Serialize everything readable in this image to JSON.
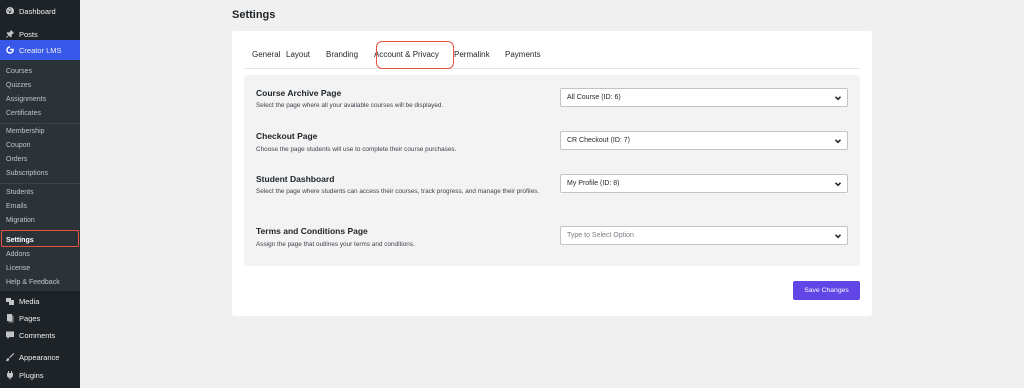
{
  "sidebar": {
    "top": [
      {
        "label": "Dashboard",
        "icon": "dashboard-icon"
      },
      {
        "label": "Posts",
        "icon": "pin-icon"
      },
      {
        "label": "Creator LMS",
        "icon": "creator-lms-icon"
      }
    ],
    "submenu": [
      "Courses",
      "Quizzes",
      "Assignments",
      "Certificates",
      "Membership",
      "Coupon",
      "Orders",
      "Subscriptions",
      "Students",
      "Emails",
      "Migration",
      "Settings",
      "Addons",
      "License",
      "Help & Feedback"
    ],
    "bottom": [
      {
        "label": "Media",
        "icon": "media-icon"
      },
      {
        "label": "Pages",
        "icon": "pages-icon"
      },
      {
        "label": "Comments",
        "icon": "comments-icon"
      },
      {
        "label": "Appearance",
        "icon": "appearance-icon"
      },
      {
        "label": "Plugins",
        "icon": "plugins-icon"
      }
    ]
  },
  "page": {
    "title": "Settings"
  },
  "tabs": [
    "General",
    "Layout",
    "Branding",
    "Account & Privacy",
    "Permalink",
    "Payments"
  ],
  "rows": [
    {
      "title": "Course Archive Page",
      "desc": "Select the page where all your available courses will be displayed.",
      "value": "All Course (ID: 6)"
    },
    {
      "title": "Checkout Page",
      "desc": "Choose the page students will use to complete their course purchases.",
      "value": "CR Checkout (ID: 7)"
    },
    {
      "title": "Student Dashboard",
      "desc": "Select the page where students can access their courses, track progress, and manage their profiles.",
      "value": "My Profile (ID: 8)"
    },
    {
      "title": "Terms and Conditions Page",
      "desc": "Assign the page that outlines your terms and conditions.",
      "value": "",
      "placeholder": "Type to Select Option"
    }
  ],
  "save_label": "Save Changes",
  "colors": {
    "accent": "#3858e9",
    "button": "#6145e6",
    "highlight": "#e8553e",
    "sidebar": "#1d2327"
  }
}
